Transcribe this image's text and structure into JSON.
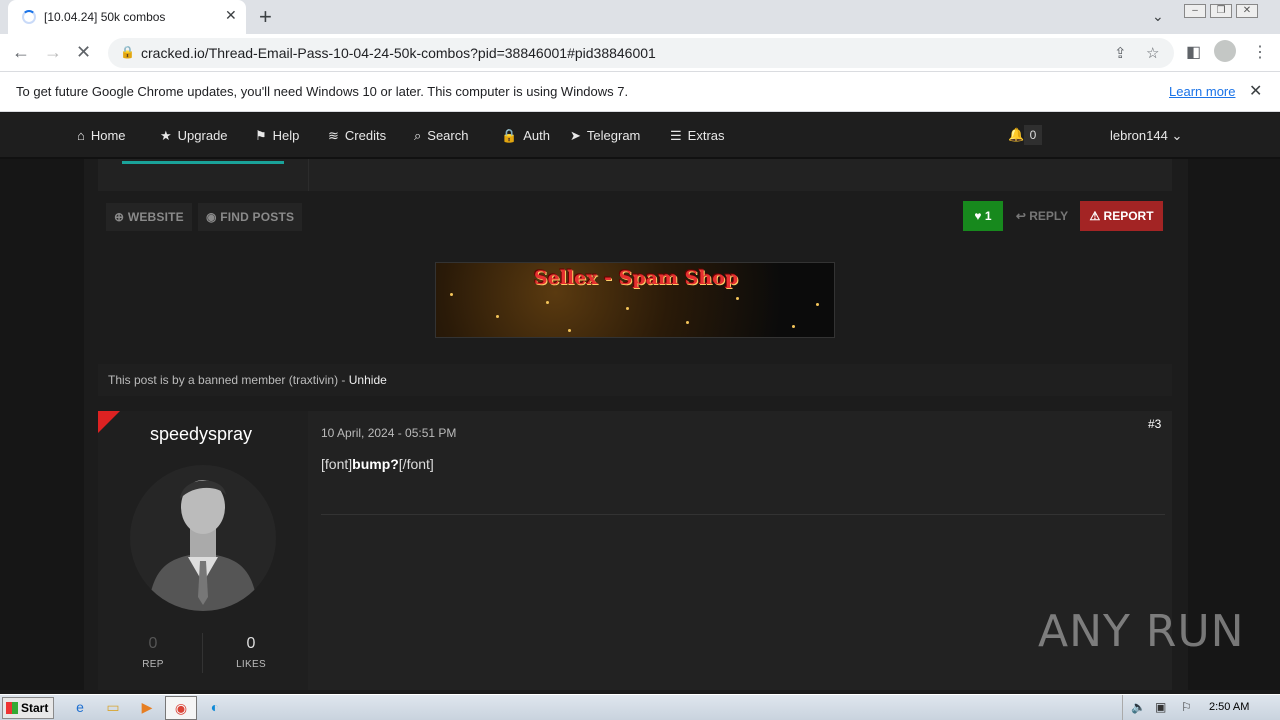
{
  "browser": {
    "tab_title": "[10.04.24] 50k combos",
    "url": "cracked.io/Thread-Email-Pass-10-04-24-50k-combos?pid=38846001#pid38846001",
    "infobar_text": "To get future Google Chrome updates, you'll need Windows 10 or later. This computer is using Windows 7.",
    "infobar_link": "Learn more"
  },
  "nav": {
    "items": [
      {
        "label": "Home",
        "icon": "home-icon"
      },
      {
        "label": "Upgrade",
        "icon": "star-icon"
      },
      {
        "label": "Help",
        "icon": "flag-icon"
      },
      {
        "label": "Credits",
        "icon": "coins-icon"
      },
      {
        "label": "Search",
        "icon": "search-icon"
      },
      {
        "label": "Auth",
        "icon": "lock-icon"
      },
      {
        "label": "Telegram",
        "icon": "telegram-icon"
      },
      {
        "label": "Extras",
        "icon": "menu-icon"
      }
    ],
    "notifications": "0",
    "username": "lebron144"
  },
  "prev_post": {
    "website_label": "WEBSITE",
    "find_posts_label": "FIND POSTS",
    "likes": "1",
    "reply_label": "REPLY",
    "report_label": "REPORT",
    "banner_text": "Sellex - Spam Shop"
  },
  "banned_notice": {
    "text": "This post is by a banned member (traxtivin) - ",
    "link": "Unhide"
  },
  "post": {
    "username": "speedyspray",
    "date": "10 April, 2024 - 05:51 PM",
    "number": "#3",
    "body_prefix": "[font]",
    "body_bold": "bump?",
    "body_suffix": "[/font]",
    "rep_value": "0",
    "rep_label": "REP",
    "likes_value": "0",
    "likes_label": "LIKES"
  },
  "watermark": "ANY RUN",
  "taskbar": {
    "start_label": "Start",
    "clock": "2:50 AM"
  }
}
